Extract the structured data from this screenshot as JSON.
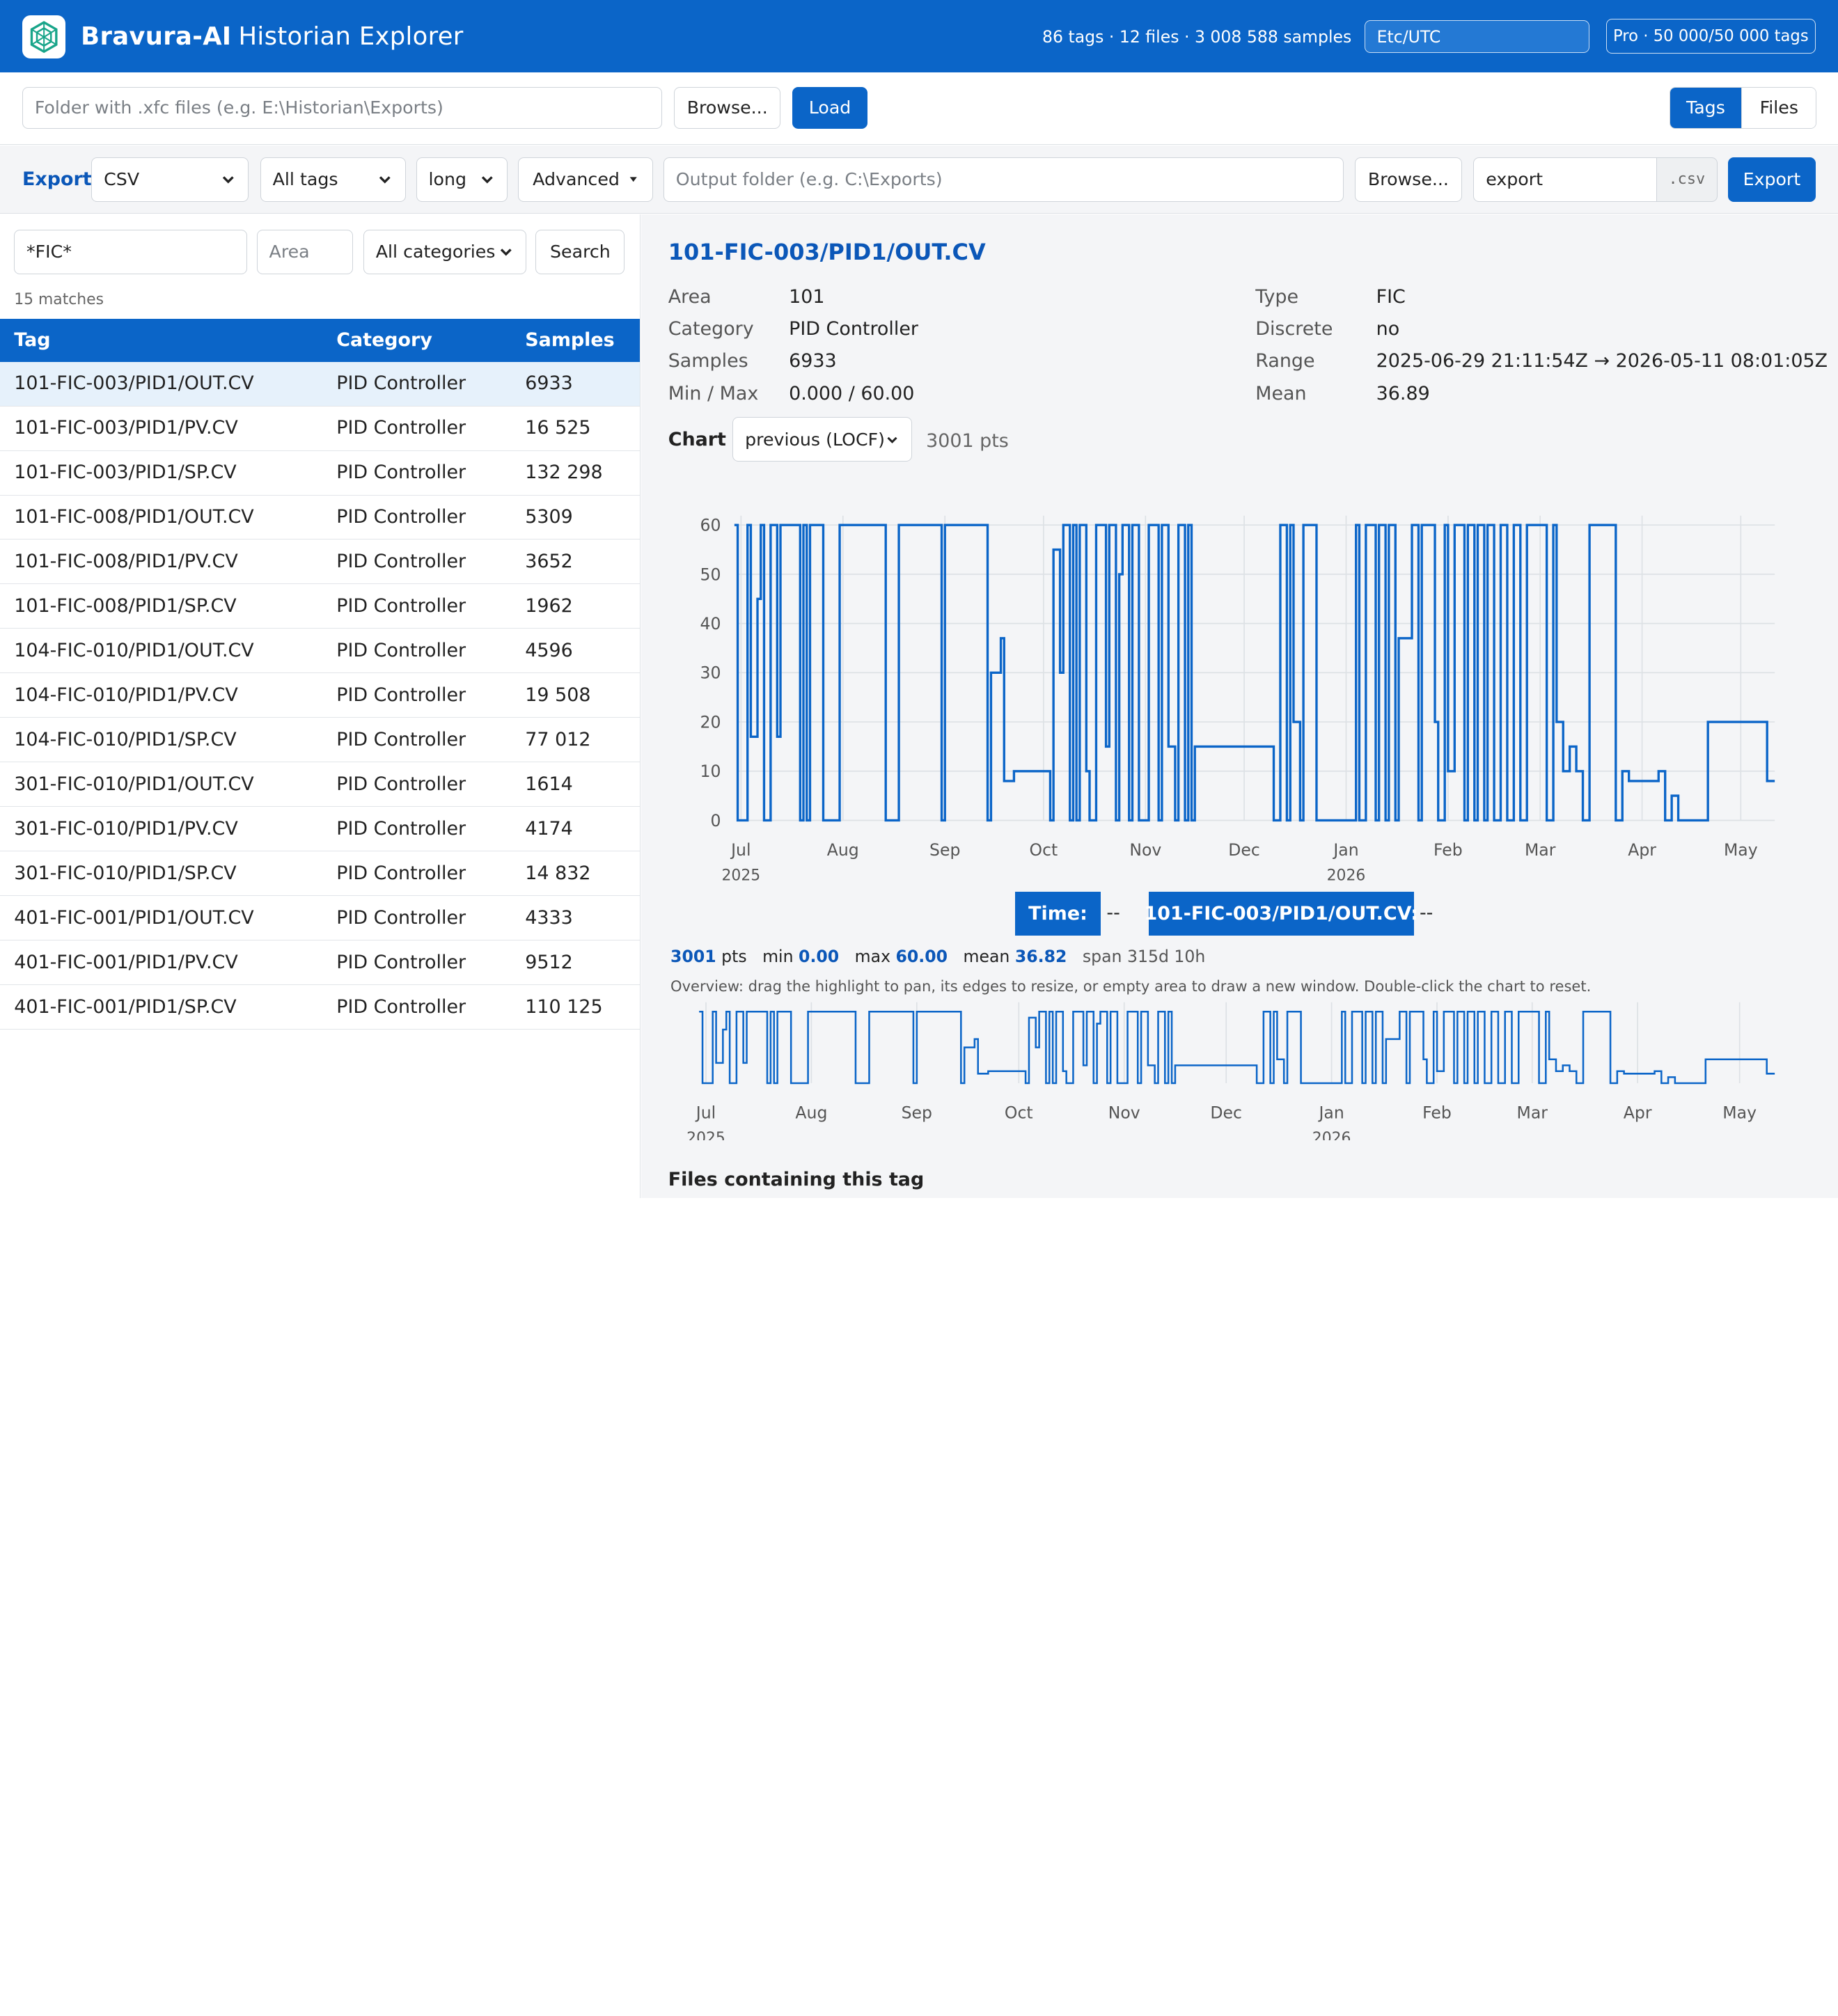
{
  "header": {
    "brand": "Bravura-AI",
    "brand_sub": "Historian Explorer",
    "stats": "86 tags · 12 files · 3 008 588 samples",
    "timezone": "Etc/UTC",
    "license": "Pro · 50 000/50 000 tags",
    "accent": "#0b65c8"
  },
  "toolbar": {
    "folder_placeholder": "Folder with .xfc files (e.g. E:\\Historian\\Exports)",
    "browse_label": "Browse...",
    "load_label": "Load",
    "view_tabs": [
      "Tags",
      "Files"
    ],
    "active_tab": "Tags"
  },
  "export_bar": {
    "label": "Export",
    "format": "CSV",
    "scope": "All tags",
    "layout": "long",
    "advanced_label": "Advanced",
    "output_placeholder": "Output folder (e.g. C:\\Exports)",
    "browse_label": "Browse...",
    "filename": "export",
    "extension": ".csv",
    "export_label": "Export"
  },
  "search": {
    "query": "*FIC*",
    "area_placeholder": "Area",
    "category": "All categories",
    "search_label": "Search",
    "matches": "15 matches"
  },
  "table": {
    "headers": [
      "Tag",
      "Category",
      "Samples"
    ],
    "rows": [
      {
        "tag": "101-FIC-003/PID1/OUT.CV",
        "category": "PID Controller",
        "samples": "6933"
      },
      {
        "tag": "101-FIC-003/PID1/PV.CV",
        "category": "PID Controller",
        "samples": "16 525"
      },
      {
        "tag": "101-FIC-003/PID1/SP.CV",
        "category": "PID Controller",
        "samples": "132 298"
      },
      {
        "tag": "101-FIC-008/PID1/OUT.CV",
        "category": "PID Controller",
        "samples": "5309"
      },
      {
        "tag": "101-FIC-008/PID1/PV.CV",
        "category": "PID Controller",
        "samples": "3652"
      },
      {
        "tag": "101-FIC-008/PID1/SP.CV",
        "category": "PID Controller",
        "samples": "1962"
      },
      {
        "tag": "104-FIC-010/PID1/OUT.CV",
        "category": "PID Controller",
        "samples": "4596"
      },
      {
        "tag": "104-FIC-010/PID1/PV.CV",
        "category": "PID Controller",
        "samples": "19 508"
      },
      {
        "tag": "104-FIC-010/PID1/SP.CV",
        "category": "PID Controller",
        "samples": "77 012"
      },
      {
        "tag": "301-FIC-010/PID1/OUT.CV",
        "category": "PID Controller",
        "samples": "1614"
      },
      {
        "tag": "301-FIC-010/PID1/PV.CV",
        "category": "PID Controller",
        "samples": "4174"
      },
      {
        "tag": "301-FIC-010/PID1/SP.CV",
        "category": "PID Controller",
        "samples": "14 832"
      },
      {
        "tag": "401-FIC-001/PID1/OUT.CV",
        "category": "PID Controller",
        "samples": "4333"
      },
      {
        "tag": "401-FIC-001/PID1/PV.CV",
        "category": "PID Controller",
        "samples": "9512"
      },
      {
        "tag": "401-FIC-001/PID1/SP.CV",
        "category": "PID Controller",
        "samples": "110 125"
      }
    ],
    "selected_index": 0
  },
  "detail": {
    "title": "101-FIC-003/PID1/OUT.CV",
    "left": [
      {
        "k": "Area",
        "v": "101"
      },
      {
        "k": "Category",
        "v": "PID Controller"
      },
      {
        "k": "Samples",
        "v": "6933"
      },
      {
        "k": "Min / Max",
        "v": "0.000 / 60.00"
      }
    ],
    "right": [
      {
        "k": "Type",
        "v": "FIC"
      },
      {
        "k": "Discrete",
        "v": "no"
      },
      {
        "k": "Range",
        "v": "2025-06-29 21:11:54Z → 2026-05-11 08:01:05Z"
      },
      {
        "k": "Mean",
        "v": "36.89"
      }
    ],
    "chart_label": "Chart",
    "interp": "previous (LOCF)",
    "chart_pts": "3001 pts",
    "tip_time_label": "Time:",
    "tip_time_value": "--",
    "tip_series_label": "101-FIC-003/PID1/OUT.CV:",
    "tip_series_value": "--",
    "summary": {
      "pts": "3001",
      "pts_label": "pts",
      "min_label": "min",
      "min": "0.00",
      "max_label": "max",
      "max": "60.00",
      "mean_label": "mean",
      "mean": "36.82",
      "span": "span 315d 10h"
    },
    "overview_note": "Overview: drag the highlight to pan, its edges to resize, or empty area to draw a new window. Double-click the chart to reset.",
    "files_heading": "Files containing this tag"
  },
  "chart_data": {
    "type": "line",
    "step": "previous",
    "color": "#0b65c8",
    "ylim": [
      0,
      60
    ],
    "y_ticks": [
      0,
      10,
      20,
      30,
      40,
      50,
      60
    ],
    "x_ticks": [
      {
        "label": "Jul",
        "year": "2025"
      },
      {
        "label": "Aug"
      },
      {
        "label": "Sep"
      },
      {
        "label": "Oct"
      },
      {
        "label": "Nov"
      },
      {
        "label": "Dec"
      },
      {
        "label": "Jan",
        "year": "2026"
      },
      {
        "label": "Feb"
      },
      {
        "label": "Mar"
      },
      {
        "label": "Apr"
      },
      {
        "label": "May"
      }
    ],
    "x": [
      "2025-06-29",
      "2025-06-30",
      "2025-07-03",
      "2025-07-04",
      "2025-07-06",
      "2025-07-07",
      "2025-07-08",
      "2025-07-10",
      "2025-07-12",
      "2025-07-13",
      "2025-07-19",
      "2025-07-20",
      "2025-07-21",
      "2025-07-22",
      "2025-07-26",
      "2025-07-31",
      "2025-08-01",
      "2025-08-14",
      "2025-08-18",
      "2025-08-31",
      "2025-09-01",
      "2025-09-04",
      "2025-09-14",
      "2025-09-15",
      "2025-09-18",
      "2025-09-19",
      "2025-09-20",
      "2025-09-22",
      "2025-10-03",
      "2025-10-04",
      "2025-10-06",
      "2025-10-07",
      "2025-10-09",
      "2025-10-10",
      "2025-10-11",
      "2025-10-12",
      "2025-10-14",
      "2025-10-15",
      "2025-10-17",
      "2025-10-20",
      "2025-10-21",
      "2025-10-23",
      "2025-10-24",
      "2025-10-25",
      "2025-10-27",
      "2025-10-28",
      "2025-10-30",
      "2025-10-31",
      "2025-11-02",
      "2025-11-05",
      "2025-11-06",
      "2025-11-08",
      "2025-11-10",
      "2025-11-11",
      "2025-11-13",
      "2025-11-14",
      "2025-11-15",
      "2025-11-16",
      "2025-12-10",
      "2025-12-12",
      "2025-12-14",
      "2025-12-15",
      "2025-12-16",
      "2025-12-18",
      "2025-12-19",
      "2025-12-21",
      "2025-12-23",
      "2026-01-04",
      "2026-01-05",
      "2026-01-07",
      "2026-01-10",
      "2026-01-11",
      "2026-01-13",
      "2026-01-14",
      "2026-01-16",
      "2026-01-17",
      "2026-01-21",
      "2026-01-23",
      "2026-01-24",
      "2026-01-28",
      "2026-01-29",
      "2026-01-31",
      "2026-02-01",
      "2026-02-03",
      "2026-02-06",
      "2026-02-07",
      "2026-02-09",
      "2026-02-10",
      "2026-02-12",
      "2026-02-13",
      "2026-02-15",
      "2026-02-17",
      "2026-02-19",
      "2026-02-21",
      "2026-02-23",
      "2026-02-25",
      "2026-03-03",
      "2026-03-05",
      "2026-03-06",
      "2026-03-08",
      "2026-03-10",
      "2026-03-12",
      "2026-03-14",
      "2026-03-16",
      "2026-03-19",
      "2026-03-24",
      "2026-03-26",
      "2026-03-28",
      "2026-03-30",
      "2026-04-06",
      "2026-04-08",
      "2026-04-10",
      "2026-04-12",
      "2026-04-17",
      "2026-04-21",
      "2026-05-07",
      "2026-05-09",
      "2026-05-11"
    ],
    "y": [
      60,
      0,
      60,
      17,
      45,
      60,
      0,
      60,
      17,
      60,
      0,
      60,
      0,
      60,
      0,
      60,
      60,
      0,
      60,
      0,
      60,
      60,
      0,
      30,
      37,
      8,
      8,
      10,
      0,
      55,
      30,
      60,
      0,
      60,
      0,
      60,
      10,
      0,
      60,
      15,
      60,
      0,
      50,
      60,
      0,
      60,
      0,
      0,
      60,
      0,
      60,
      15,
      0,
      60,
      0,
      60,
      0,
      15,
      0,
      60,
      0,
      60,
      20,
      0,
      60,
      60,
      0,
      60,
      0,
      60,
      0,
      60,
      0,
      60,
      0,
      37,
      60,
      0,
      60,
      20,
      0,
      60,
      10,
      60,
      0,
      60,
      0,
      60,
      0,
      60,
      0,
      60,
      0,
      60,
      0,
      60,
      0,
      60,
      20,
      10,
      15,
      10,
      0,
      60,
      60,
      0,
      10,
      8,
      8,
      10,
      0,
      5,
      0,
      0,
      20,
      20,
      8,
      8
    ]
  }
}
